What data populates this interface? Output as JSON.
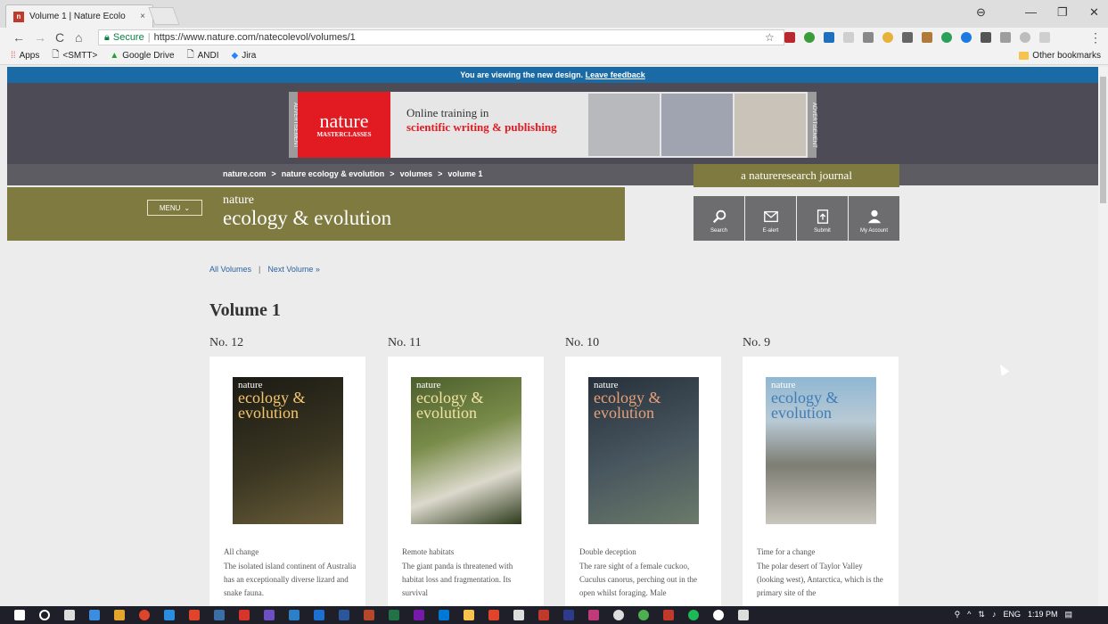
{
  "browser": {
    "tab_title": "Volume 1 | Nature Ecolo",
    "tab_close": "×",
    "favicon_letter": "n",
    "window_controls": [
      "⊖",
      "—",
      "❐",
      "✕"
    ],
    "secure_label": "Secure",
    "url": "https://www.nature.com/natecolevol/volumes/1",
    "bookmarks": [
      "Apps",
      "<SMTT>",
      "Google Drive",
      "ANDI",
      "Jira"
    ],
    "other_bookmarks": "Other bookmarks"
  },
  "page": {
    "banner_text": "You are viewing the new design.",
    "banner_link": "Leave feedback",
    "ad": {
      "label": "ADVERTISEMENT",
      "brand": "nature",
      "brand_sub": "MASTERCLASSES",
      "line1": "Online training in",
      "line2": "scientific writing & publishing"
    },
    "breadcrumb": [
      "nature.com",
      ">",
      "nature ecology & evolution",
      ">",
      "volumes",
      ">",
      "volume 1"
    ],
    "network_tag": "a natureresearch journal",
    "menu_label": "MENU",
    "journal_title_a": "nature",
    "journal_title_b": "ecology & evolution",
    "actions": {
      "search": "Search",
      "ealert": "E-alert",
      "submit": "Submit",
      "account": "My Account"
    },
    "volnav": {
      "all": "All Volumes",
      "divider": "|",
      "next": "Next Volume",
      "next_arrow": "»"
    },
    "volume_heading": "Volume 1",
    "issues": [
      {
        "no": "No. 12",
        "title": "All change",
        "desc": "The isolated island continent of Australia has an exceptionally diverse lizard and snake fauna."
      },
      {
        "no": "No. 11",
        "title": "Remote habitats",
        "desc": "The giant panda is threatened with habitat loss and fragmentation. Its survival"
      },
      {
        "no": "No. 10",
        "title": "Double deception",
        "desc": "The rare sight of a female cuckoo, Cuculus canorus, perching out in the open whilst foraging. Male"
      },
      {
        "no": "No. 9",
        "title": "Time for a change",
        "desc": "The polar desert of Taylor Valley (looking west), Antarctica, which is the primary site of the"
      }
    ],
    "cover_brand": "nature",
    "cover_title": "ecology & evolution"
  },
  "taskbar": {
    "lang": "ENG",
    "time": "1:19 PM"
  },
  "colors": {
    "banner": "#1a6ba5",
    "olive": "#7f7a3f",
    "dark_bar": "#4d4c56"
  }
}
